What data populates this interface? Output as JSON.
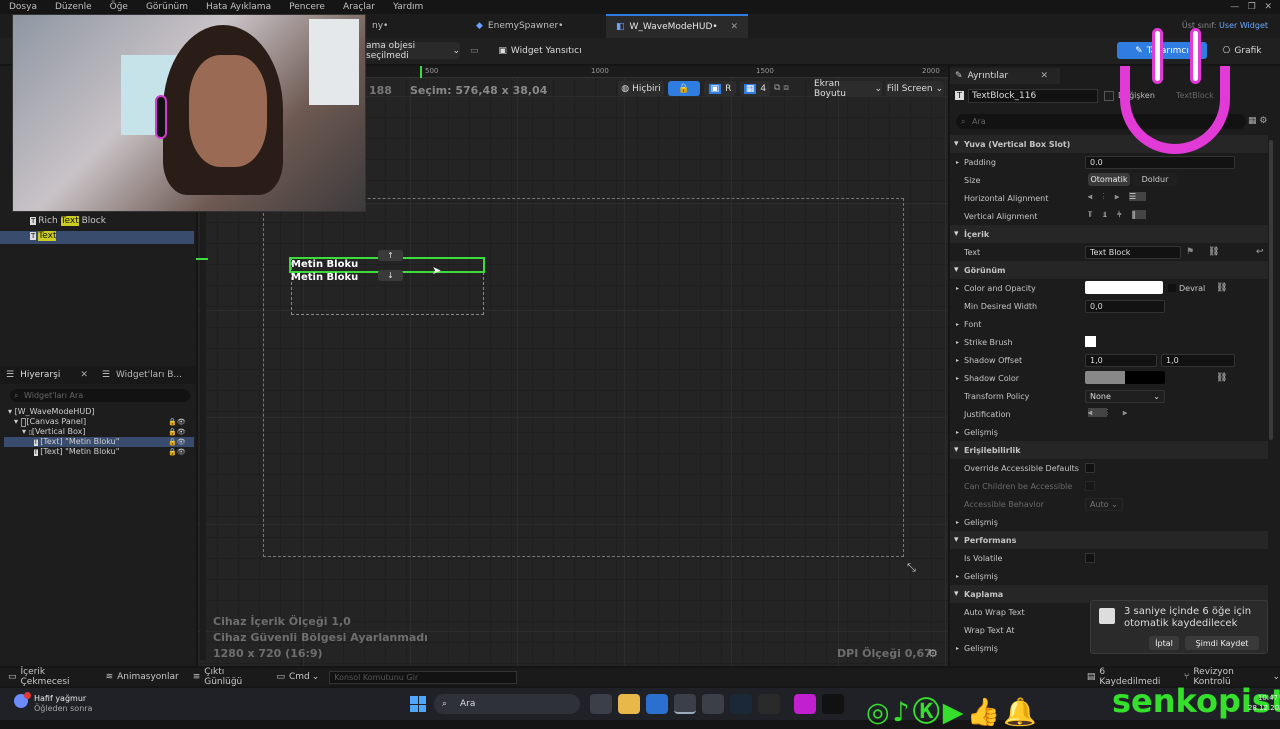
{
  "menu": [
    "Dosya",
    "Düzenle",
    "Öğe",
    "Görünüm",
    "Hata Ayıklama",
    "Pencere",
    "Araçlar",
    "Yardım"
  ],
  "tabs": {
    "partial": "ny•",
    "spawner": "EnemySpawner•",
    "hud": "W_WaveModeHUD•"
  },
  "parent_class": {
    "label": "Üst sınıf:",
    "value": "User Widget"
  },
  "toolbar": {
    "select": "ama objesi seçilmedi",
    "reflector": "Widget Yansıtıcı",
    "designer": "Tasarımcı",
    "graph": "Grafik"
  },
  "canvas_bar": {
    "none": "Hiçbiri",
    "r": "R",
    "grid": "4",
    "screen_size": "Ekran Boyutu",
    "fill": "Fill Screen",
    "left_num": "188",
    "selection": "Seçim: 576,48 x 38,04"
  },
  "ruler": [
    "500",
    "1000",
    "1500",
    "2000"
  ],
  "widgets": {
    "text1": "Metin Bloku",
    "text2": "Metin Bloku"
  },
  "canvas_info": {
    "line1": "Cihaz İçerik Ölçeği 1,0",
    "line2": "Cihaz Güvenli Bölgesi Ayarlanmadı",
    "line3": "1280 x 720 (16:9)",
    "dpi": "DPI Ölçeği 0,67"
  },
  "palette": {
    "rich": "Rich Text Block",
    "rich_pre": "Rich ",
    "rich_mid": "Text",
    "rich_post": " Block",
    "text": "Text"
  },
  "hierarchy": {
    "tab": "Hiyerarşi",
    "tab2": "Widget'ları B...",
    "search": "Widget'ları Ara",
    "items": [
      "[W_WaveModeHUD]",
      "[Canvas Panel]",
      "[Vertical Box]",
      "[Text] \"Metin Bloku\"",
      "[Text] \"Metin Bloku\""
    ]
  },
  "details": {
    "tab": "Ayrıntılar",
    "name": "TextBlock_116",
    "is_var": "Değişken",
    "class": "TextBlock",
    "search": "Ara",
    "sections": {
      "slot": "Yuva (Vertical Box Slot)",
      "content": "İçerik",
      "appearance": "Görünüm",
      "access": "Erişilebilirlik",
      "perf": "Performans",
      "wrap": "Kaplama"
    },
    "padding": {
      "label": "Padding",
      "value": "0.0"
    },
    "size": {
      "label": "Size",
      "auto": "Otomatik",
      "fill": "Doldur"
    },
    "halign": "Horizontal Alignment",
    "valign": "Vertical Alignment",
    "text": {
      "label": "Text",
      "value": "Text Block"
    },
    "color": {
      "label": "Color and Opacity",
      "inherit": "Devral"
    },
    "min_width": {
      "label": "Min Desired Width",
      "value": "0,0"
    },
    "font": "Font",
    "strike": "Strike Brush",
    "shadow_offset": {
      "label": "Shadow Offset",
      "x": "1,0",
      "y": "1,0"
    },
    "shadow_color": "Shadow Color",
    "transform": {
      "label": "Transform Policy",
      "value": "None"
    },
    "justification": "Justification",
    "advanced": "Gelişmiş",
    "override": "Override Accessible Defaults",
    "children": "Can Children be Accessible",
    "behavior": {
      "label": "Accessible Behavior",
      "value": "Auto"
    },
    "volatile": "Is Volatile",
    "autowrap": "Auto Wrap Text",
    "wrapat": "Wrap Text At"
  },
  "notify": {
    "msg": "3 saniye içinde 6 öğe için otomatik kaydedilecek",
    "cancel": "İptal",
    "save": "Şimdi Kaydet"
  },
  "status": {
    "drawer": "İçerik Çekmecesi",
    "anim": "Animasyonlar",
    "output": "Çıktı Günlüğü",
    "cmd": "Cmd",
    "console": "Konsol Komutunu Gir",
    "saved": "6 Kaydedilmedi",
    "rev": "Revizyon Kontrolü"
  },
  "taskbar": {
    "weather1": "Hafif yağmur",
    "weather2": "Öğleden sonra",
    "search": "Ara",
    "time": "10:47",
    "date": "28.12.2025"
  },
  "overlay": {
    "brand": "senkopist"
  },
  "colors": {
    "accent": "#2f7de1",
    "selection": "#3ddc3d",
    "brand_green": "#35e02c",
    "smiley": "#e23ad7"
  }
}
